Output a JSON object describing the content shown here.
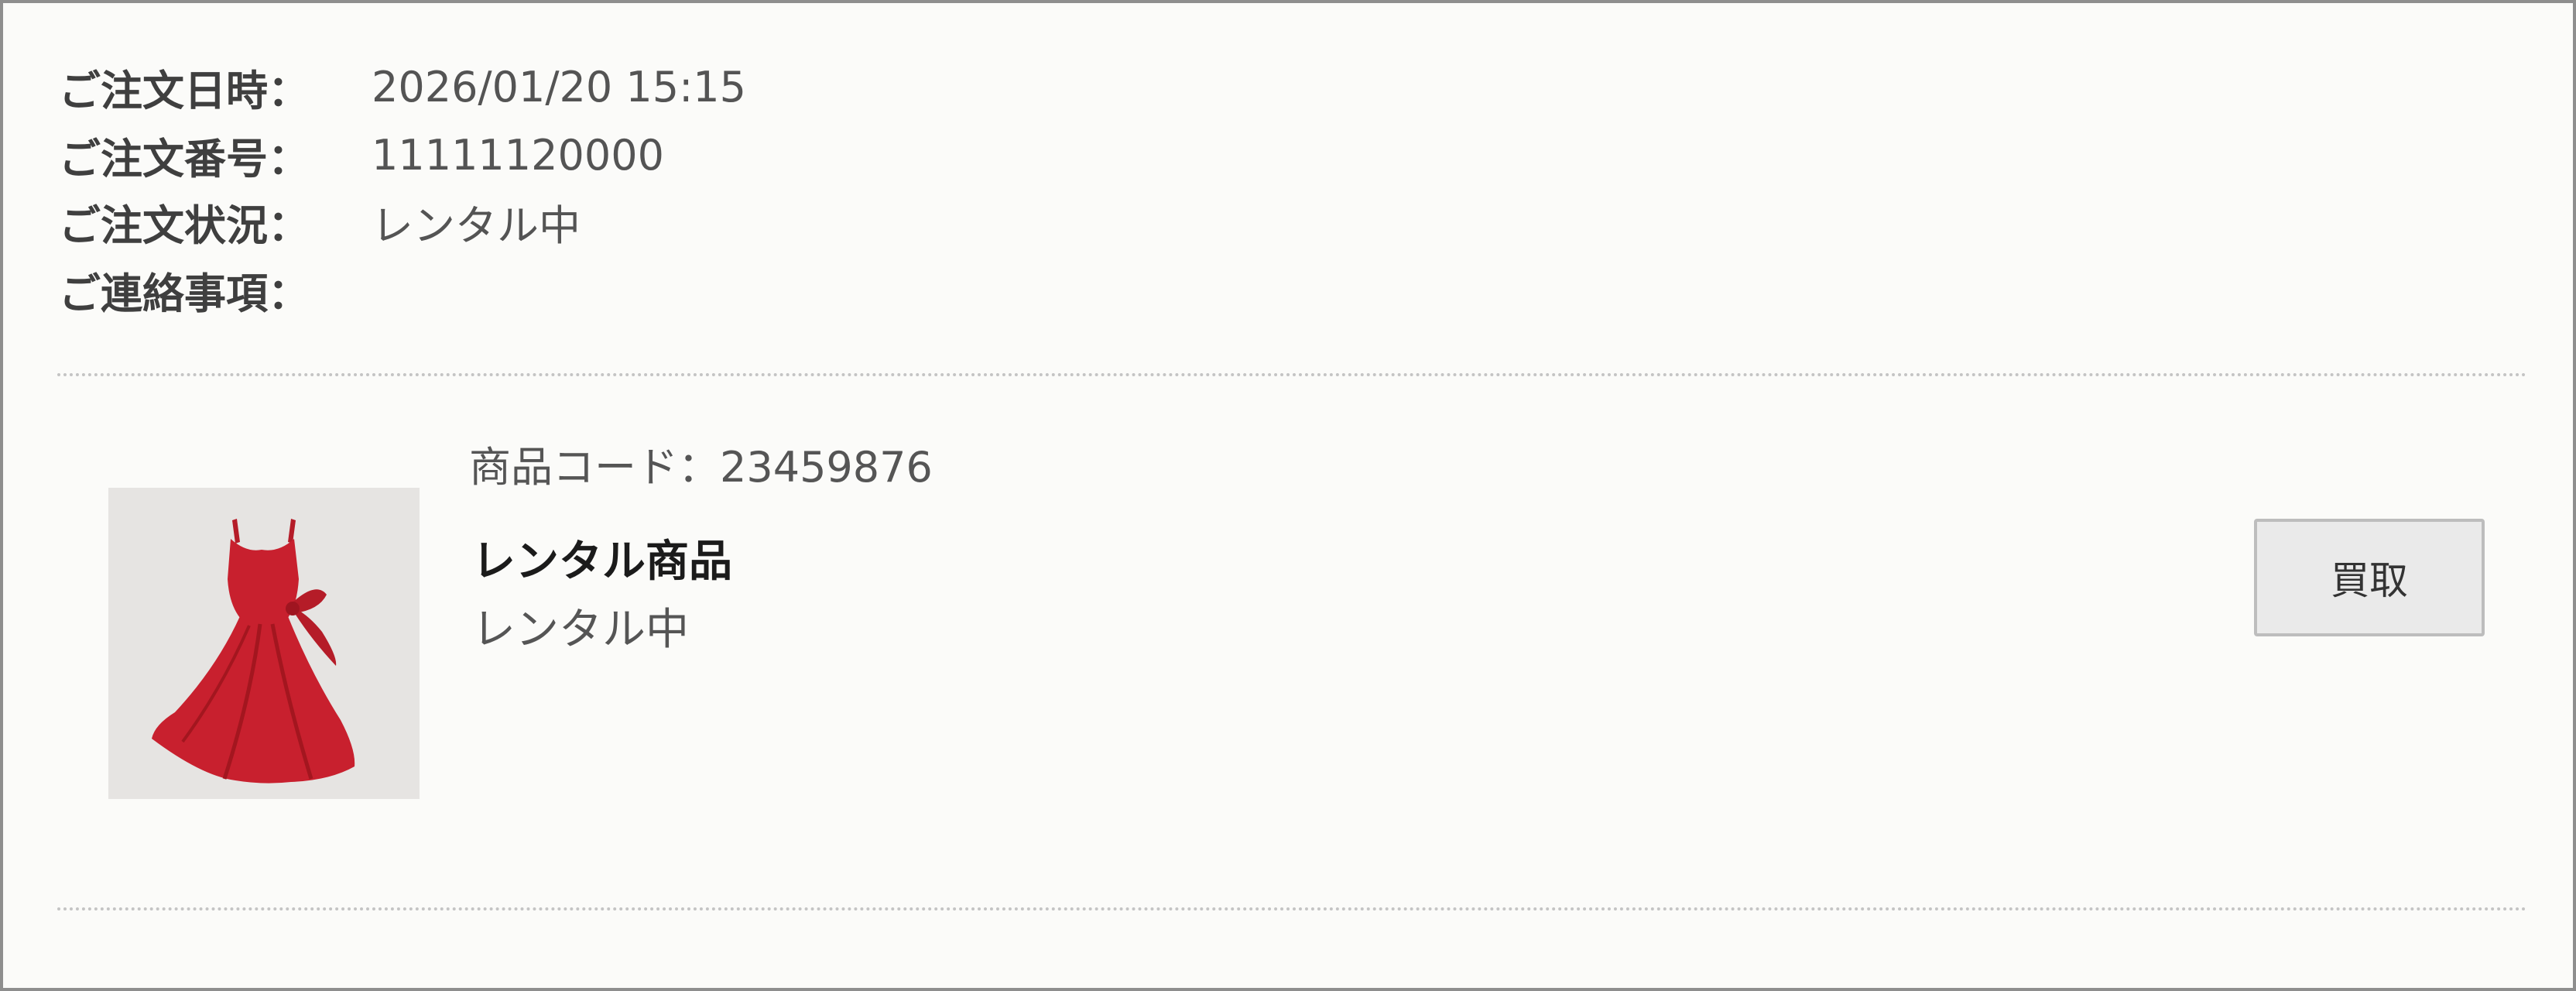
{
  "order": {
    "date_label": "ご注文日時：",
    "date_value": "2026/01/20 15:15",
    "number_label": "ご注文番号：",
    "number_value": "11111120000",
    "status_label": "ご注文状況：",
    "status_value": "レンタル中",
    "notes_label": "ご連絡事項：",
    "notes_value": ""
  },
  "item": {
    "thumbnail_icon": "red-dress-image",
    "code_text": "商品コード：23459876",
    "name": "レンタル商品",
    "status": "レンタル中",
    "buy_button_label": "買取"
  },
  "colors": {
    "dress": "#c8202e",
    "thumbnail_bg": "#e6e4e2",
    "button_bg": "#eaeaea"
  }
}
